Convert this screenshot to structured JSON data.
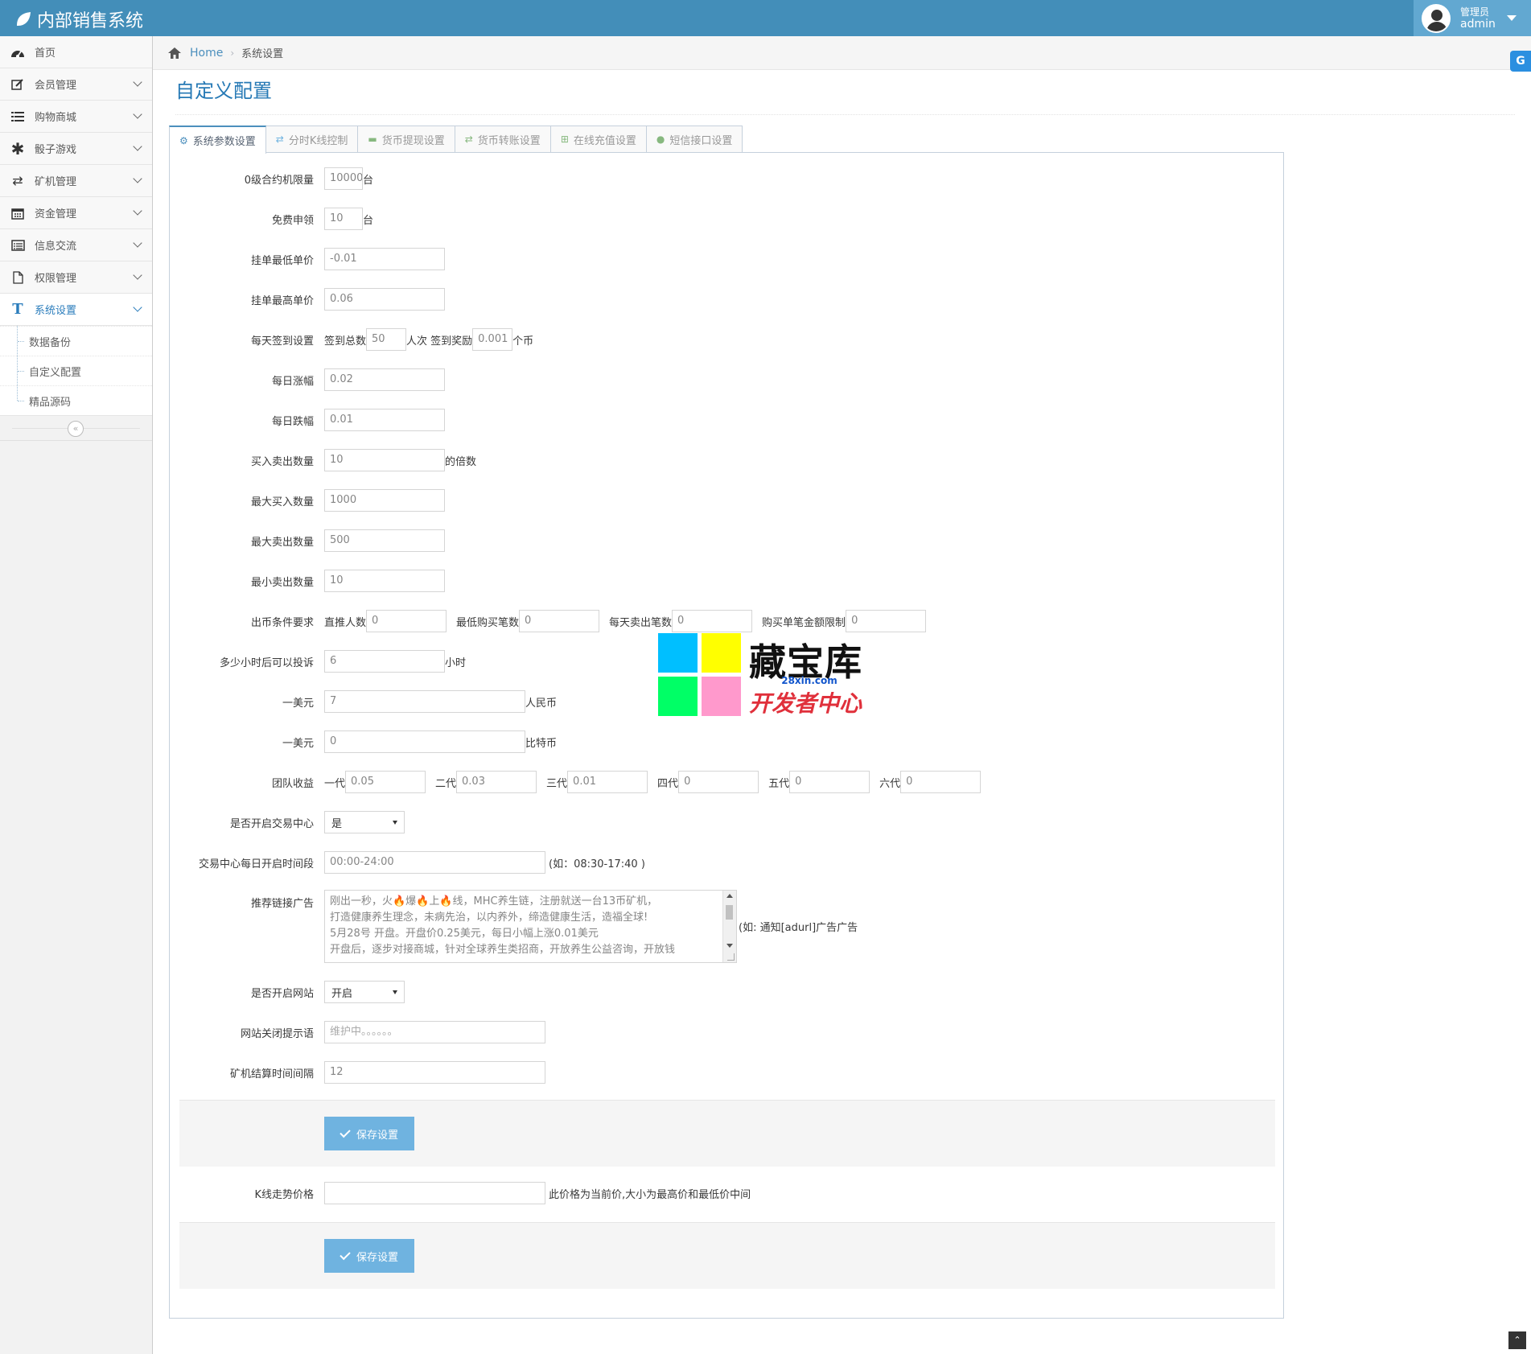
{
  "app": {
    "title": "内部销售系统"
  },
  "user": {
    "role": "管理员",
    "name": "admin"
  },
  "sidebar": {
    "items": [
      {
        "label": "首页",
        "icon": "dashboard-icon"
      },
      {
        "label": "会员管理",
        "icon": "edit-icon"
      },
      {
        "label": "购物商城",
        "icon": "list-icon"
      },
      {
        "label": "骰子游戏",
        "icon": "asterisk-icon"
      },
      {
        "label": "矿机管理",
        "icon": "random-icon"
      },
      {
        "label": "资金管理",
        "icon": "calendar-icon"
      },
      {
        "label": "信息交流",
        "icon": "list-alt-icon"
      },
      {
        "label": "权限管理",
        "icon": "file-icon"
      },
      {
        "label": "系统设置",
        "icon": "text-icon"
      }
    ],
    "sub_items": [
      "数据备份",
      "自定义配置",
      "精品源码"
    ]
  },
  "breadcrumb": {
    "home": "Home",
    "current": "系统设置"
  },
  "page": {
    "title": "自定义配置"
  },
  "tabs": [
    {
      "label": "系统参数设置",
      "icon": "cogs-icon"
    },
    {
      "label": "分时K线控制",
      "icon": "exchange-icon"
    },
    {
      "label": "货币提现设置",
      "icon": "credit-card-icon"
    },
    {
      "label": "货币转账设置",
      "icon": "exchange-icon"
    },
    {
      "label": "在线充值设置",
      "icon": "plus-square-icon"
    },
    {
      "label": "短信接口设置",
      "icon": "user-icon"
    }
  ],
  "form": {
    "level0": {
      "label": "0级合约机限量",
      "value": "10000",
      "unit": "台"
    },
    "free": {
      "label": "免费申领",
      "value": "10",
      "unit": "台"
    },
    "min_price": {
      "label": "挂单最低单价",
      "value": "-0.01"
    },
    "max_price": {
      "label": "挂单最高单价",
      "value": "0.06"
    },
    "signin": {
      "label": "每天签到设置",
      "pre1": "签到总数",
      "v1": "50",
      "mid": "人次 签到奖励",
      "v2": "0.001",
      "post": "个币"
    },
    "daily_up": {
      "label": "每日涨幅",
      "value": "0.02"
    },
    "daily_down": {
      "label": "每日跌幅",
      "value": "0.01"
    },
    "multiple": {
      "label": "买入卖出数量",
      "value": "10",
      "unit": "的倍数"
    },
    "max_buy": {
      "label": "最大买入数量",
      "value": "1000"
    },
    "max_sell": {
      "label": "最大卖出数量",
      "value": "500"
    },
    "min_sell": {
      "label": "最小卖出数量",
      "value": "10"
    },
    "sell_cond": {
      "label": "出币条件要求",
      "parts": [
        {
          "pre": "直推人数",
          "value": "0"
        },
        {
          "pre": "最低购买笔数",
          "value": "0"
        },
        {
          "pre": "每天卖出笔数",
          "value": "0"
        },
        {
          "pre": "购买单笔金额限制",
          "value": "0"
        }
      ]
    },
    "complain": {
      "label": "多少小时后可以投诉",
      "value": "6",
      "unit": "小时"
    },
    "usd_rmb": {
      "label": "一美元",
      "value": "7",
      "unit": "人民币"
    },
    "usd_btc": {
      "label": "一美元",
      "value": "0",
      "unit": "比特币"
    },
    "team": {
      "label": "团队收益",
      "parts": [
        {
          "pre": "一代",
          "value": "0.05"
        },
        {
          "pre": "二代",
          "value": "0.03"
        },
        {
          "pre": "三代",
          "value": "0.01"
        },
        {
          "pre": "四代",
          "value": "0"
        },
        {
          "pre": "五代",
          "value": "0"
        },
        {
          "pre": "六代",
          "value": "0"
        }
      ]
    },
    "trade_open": {
      "label": "是否开启交易中心",
      "value": "是"
    },
    "trade_time": {
      "label": "交易中心每日开启时间段",
      "value": "00:00-24:00",
      "hint": "(如：08:30-17:40 )"
    },
    "ad": {
      "label": "推荐链接广告",
      "lines": [
        "刚出一秒，火🔥爆🔥上🔥线，MHC养生链，注册就送一台13币矿机，",
        "打造健康养生理念，未病先治，以内养外，缔造健康生活，造福全球!",
        "5月28号 开盘。开盘价0.25美元，每日小幅上涨0.01美元",
        " 开盘后，逐步对接商城，针对全球养生类招商，开放养生公益咨询，开放钱"
      ],
      "hint": "(如: 通知[adurl]广告广告"
    },
    "site_open": {
      "label": "是否开启网站",
      "value": "开启"
    },
    "close_msg": {
      "label": "网站关闭提示语",
      "placeholder": "维护中。。。。。。"
    },
    "settle": {
      "label": "矿机结算时间间隔",
      "value": "12"
    },
    "save": "保存设置",
    "kline": {
      "label": "K线走势价格",
      "value": "",
      "hint": "此价格为当前价,大小为最高价和最低价中间"
    }
  },
  "watermark": {
    "line1": "藏宝库",
    "url": "28xin.com",
    "line2": "开发者中心"
  },
  "colors": {
    "navbar": "#438eb9",
    "accent": "#2679b5",
    "button": "#6fb3e0"
  }
}
